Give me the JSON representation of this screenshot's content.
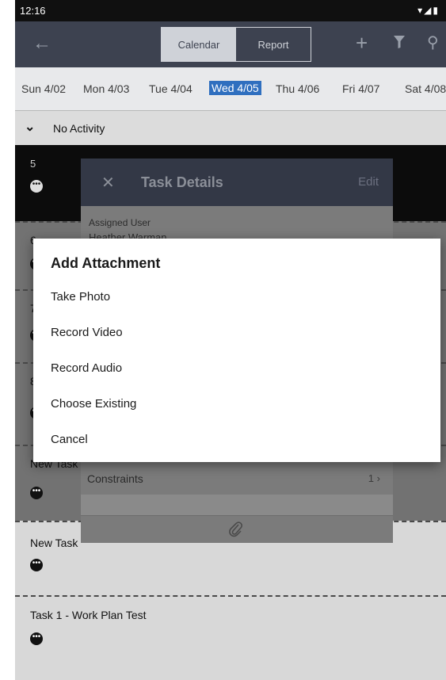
{
  "status_bar": {
    "time": "12:16",
    "icons": "▾◢▮"
  },
  "toolbar": {
    "back_icon": "arrow-left-icon",
    "tabs": [
      "Calendar",
      "Report"
    ],
    "active_tab": "Calendar",
    "add_icon": "plus-icon",
    "filter_icon": "filter-icon",
    "search_icon": "search-icon"
  },
  "dates": [
    "Sun 4/02",
    "Mon 4/03",
    "Tue 4/04",
    "Wed 4/05",
    "Thu 4/06",
    "Fri 4/07",
    "Sat 4/08"
  ],
  "selected_date": "Wed 4/05",
  "no_activity_label": "No Activity",
  "rows": [
    {
      "label": "5"
    },
    {
      "label": "6"
    },
    {
      "label": "7"
    },
    {
      "label": "8"
    },
    {
      "label": "New Task"
    },
    {
      "label": "New Task"
    },
    {
      "label": "Task 1 - Work Plan Test"
    }
  ],
  "task_details": {
    "title": "Task Details",
    "edit_label": "Edit",
    "assigned_user_label": "Assigned User",
    "assigned_user_value": "Heather Warman",
    "constraints_label": "Constraints",
    "constraints_value": "1"
  },
  "dialog": {
    "title": "Add Attachment",
    "options": [
      "Take Photo",
      "Record Video",
      "Record Audio",
      "Choose Existing",
      "Cancel"
    ]
  }
}
